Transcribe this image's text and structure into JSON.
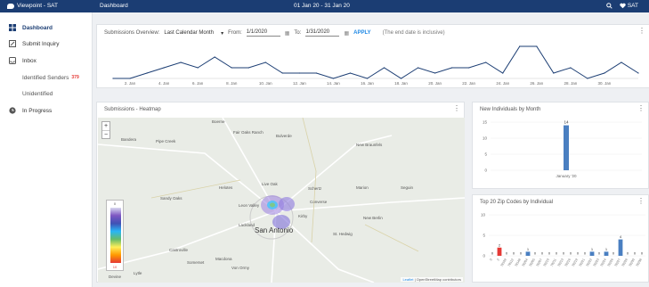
{
  "topbar": {
    "brand": "Viewpoint - SAT",
    "page": "Dashboard",
    "range": "01 Jan 20 - 31 Jan 20",
    "search_icon": "search-icon",
    "user_icon": "heart-icon",
    "user": "SAT"
  },
  "sidebar": {
    "items": [
      {
        "label": "Dashboard",
        "icon": "dashboard-icon"
      },
      {
        "label": "Submit Inquiry",
        "icon": "inquiry-icon"
      },
      {
        "label": "Inbox",
        "icon": "inbox-icon"
      },
      {
        "label": "Identified Senders",
        "badge": "379"
      },
      {
        "label": "Unidentified"
      },
      {
        "label": "In Progress",
        "icon": "clock-icon"
      }
    ]
  },
  "overview": {
    "label": "Submissions Overview:",
    "period": "Last Calendar Month",
    "from_label": "From:",
    "from": "1/1/2020",
    "to_label": "To:",
    "to": "1/31/2020",
    "apply": "APPLY",
    "note": "(The end date is inclusive)",
    "chart_data": {
      "type": "line",
      "x": [
        "1. Jan",
        "2. Jan",
        "3. Jan",
        "4. Jan",
        "5. Jan",
        "6. Jan",
        "7. Jan",
        "8. Jan",
        "9. Jan",
        "10. Jan",
        "11. Jan",
        "12. Jan",
        "13. Jan",
        "14. Jan",
        "15. Jan",
        "16. Jan",
        "17. Jan",
        "18. Jan",
        "19. Jan",
        "20. Jan",
        "21. Jan",
        "22. Jan",
        "23. Jan",
        "24. Jan",
        "25. Jan",
        "26. Jan",
        "27. Jan",
        "28. Jan",
        "29. Jan",
        "30. Jan",
        "31. Jan"
      ],
      "values": [
        0,
        0,
        1,
        2,
        3,
        2,
        4,
        2,
        2,
        3,
        1,
        1,
        1,
        0,
        1,
        0,
        2,
        0,
        2,
        1,
        2,
        2,
        3,
        1,
        6,
        6,
        1,
        2,
        0,
        1,
        3,
        1
      ],
      "tick_labels": [
        "2. Jan",
        "4. Jan",
        "6. Jan",
        "8. Jan",
        "10. Jan",
        "12. Jan",
        "14. Jan",
        "16. Jan",
        "18. Jan",
        "20. Jan",
        "22. Jan",
        "24. Jan",
        "26. Jan",
        "28. Jan",
        "30. Jan"
      ],
      "color": "#1b3d73"
    }
  },
  "heatmap": {
    "title": "Submissions - Heatmap",
    "zoom_in": "+",
    "zoom_out": "−",
    "legend_min": "0",
    "legend_max": "10",
    "places": [
      "Boerne",
      "Fair Oaks Ranch",
      "Bulverde",
      "New Braunfels",
      "Bandera",
      "Pipe Creek",
      "Helotes",
      "Live Oak",
      "Schertz",
      "Marion",
      "Seguin",
      "Converse",
      "Leon Valley",
      "Kirby",
      "Lackland",
      "Sandy Oaks",
      "San Antonio",
      "St. Hedwig",
      "New Berlin",
      "Castroville",
      "Macdona",
      "Von Ormy",
      "Somerset",
      "Lytle",
      "Devine"
    ],
    "attribution_leaflet": "Leaflet",
    "attribution": "| OpenStreetMap contributors"
  },
  "individuals": {
    "title": "New Individuals by Month",
    "chart_data": {
      "type": "bar",
      "categories": [
        "January '20"
      ],
      "values": [
        14
      ],
      "yticks": [
        0,
        5,
        10,
        15
      ],
      "ylim": [
        0,
        15
      ],
      "color": "#4a7fc1"
    }
  },
  "zipcodes": {
    "title": "Top 20 Zip Codes by Individual",
    "chart_data": {
      "type": "bar",
      "categories": [
        "0",
        "2",
        "78109",
        "78112",
        "78148",
        "78204",
        "78205",
        "78207",
        "78210",
        "78211",
        "78213",
        "78216",
        "78219",
        "78221",
        "78222",
        "78223",
        "78224",
        "78226",
        "78227",
        "78228",
        "78230",
        "78238"
      ],
      "values": [
        0,
        2,
        0,
        0,
        0,
        1,
        0,
        0,
        0,
        0,
        0,
        0,
        0,
        0,
        1,
        0,
        1,
        0,
        4,
        0,
        0,
        0
      ],
      "colors": [
        "#e53935",
        "#e53935",
        "#e53935",
        "#e53935",
        "#e53935",
        "#4a7fc1",
        "#e53935",
        "#e53935",
        "#e53935",
        "#e53935",
        "#e53935",
        "#e53935",
        "#e53935",
        "#e53935",
        "#4a7fc1",
        "#e53935",
        "#4a7fc1",
        "#e53935",
        "#4a7fc1",
        "#e53935",
        "#e53935",
        "#e53935"
      ],
      "yticks": [
        0,
        5,
        10
      ],
      "ylim": [
        0,
        10
      ]
    }
  }
}
